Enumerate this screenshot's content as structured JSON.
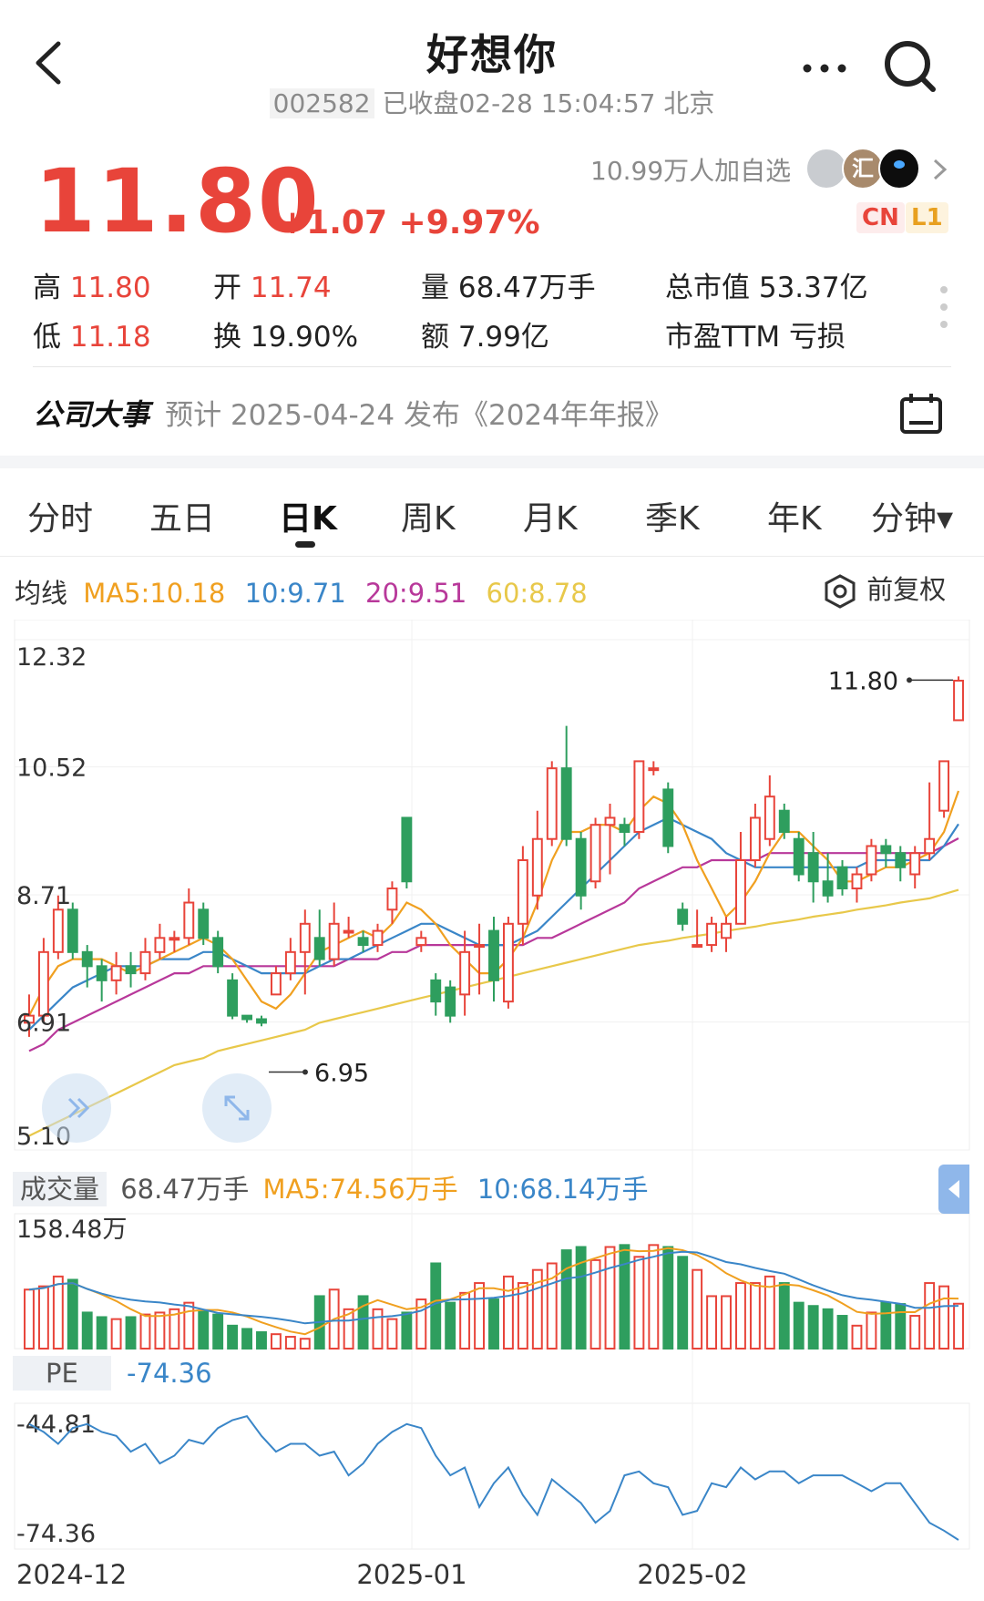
{
  "header": {
    "title": "好想你",
    "code": "002582",
    "status": "已收盘02-28 15:04:57 北京"
  },
  "quote": {
    "price": "11.80",
    "change": "+1.07",
    "change_pct": "+9.97%",
    "watchers": "10.99万人加自选",
    "badge_cn": "CN",
    "badge_l1": "L1",
    "avatar_text": "汇"
  },
  "stats": {
    "high_label": "高",
    "high_value": "11.80",
    "open_label": "开",
    "open_value": "11.74",
    "volume_label": "量",
    "volume_value": "68.47万手",
    "mktcap_label": "总市值",
    "mktcap_value": "53.37亿",
    "low_label": "低",
    "low_value": "11.18",
    "turnover_label": "换",
    "turnover_value": "19.90%",
    "amount_label": "额",
    "amount_value": "7.99亿",
    "pe_label": "市盈TTM",
    "pe_value": "亏损"
  },
  "event": {
    "label": "公司大事",
    "text": "预计 2025-04-24 发布《2024年年报》"
  },
  "tabs": [
    "分时",
    "五日",
    "日K",
    "周K",
    "月K",
    "季K",
    "年K",
    "分钟▾"
  ],
  "active_tab": 2,
  "ma": {
    "label": "均线",
    "ma5": "MA5:10.18",
    "ma10": "10:9.71",
    "ma20": "20:9.51",
    "ma60": "60:8.78",
    "adjust": "前复权"
  },
  "colors": {
    "up": "#e8443a",
    "down": "#2e9e5e",
    "ma5": "#f0a020",
    "ma10": "#3a86c8",
    "ma20": "#b8389a",
    "ma60": "#e8c84a"
  },
  "volume": {
    "label": "成交量",
    "value": "68.47万手",
    "ma5": "MA5:74.56万手",
    "ma10": "10:68.14万手",
    "max_label": "158.48万"
  },
  "pe": {
    "label": "PE",
    "value": "-74.36",
    "top_label": "-44.81",
    "bottom_label": "-74.36"
  },
  "chart_data": {
    "type": "candlestick",
    "y_ticks": [
      "12.32",
      "10.52",
      "8.71",
      "6.91",
      "5.10"
    ],
    "ylim": [
      5.1,
      12.32
    ],
    "x_ticks": [
      "2024-12",
      "2025-01",
      "2025-02"
    ],
    "high_marker": "11.80",
    "low_marker": "6.95",
    "candles": [
      [
        6.9,
        7.0,
        6.7,
        7.3
      ],
      [
        7.0,
        7.9,
        6.9,
        8.1
      ],
      [
        7.9,
        8.5,
        7.8,
        8.7
      ],
      [
        8.5,
        7.9,
        7.8,
        8.6
      ],
      [
        7.9,
        7.7,
        7.4,
        8.0
      ],
      [
        7.7,
        7.5,
        7.2,
        7.8
      ],
      [
        7.5,
        7.7,
        7.3,
        7.9
      ],
      [
        7.7,
        7.6,
        7.4,
        7.9
      ],
      [
        7.6,
        7.9,
        7.5,
        8.1
      ],
      [
        7.9,
        8.1,
        7.8,
        8.3
      ],
      [
        8.1,
        8.1,
        7.9,
        8.2
      ],
      [
        8.1,
        8.6,
        8.0,
        8.8
      ],
      [
        8.5,
        8.1,
        8.0,
        8.6
      ],
      [
        8.1,
        7.7,
        7.6,
        8.2
      ],
      [
        7.5,
        7.0,
        6.95,
        7.6
      ],
      [
        7.0,
        6.95,
        6.9,
        7.0
      ],
      [
        6.95,
        6.9,
        6.85,
        7.0
      ],
      [
        7.3,
        7.6,
        7.3,
        7.7
      ],
      [
        7.6,
        7.9,
        7.5,
        8.1
      ],
      [
        7.9,
        8.3,
        7.3,
        8.5
      ],
      [
        8.1,
        7.8,
        7.7,
        8.5
      ],
      [
        7.8,
        8.3,
        7.7,
        8.6
      ],
      [
        8.2,
        8.2,
        8.1,
        8.4
      ],
      [
        8.1,
        8.0,
        7.9,
        8.2
      ],
      [
        8.0,
        8.2,
        7.9,
        8.3
      ],
      [
        8.5,
        8.8,
        8.3,
        8.9
      ],
      [
        9.8,
        8.9,
        8.8,
        9.8
      ],
      [
        8.0,
        8.1,
        7.9,
        8.2
      ],
      [
        7.5,
        7.2,
        7.0,
        7.6
      ],
      [
        7.4,
        7.0,
        6.9,
        7.5
      ],
      [
        7.3,
        7.9,
        7.0,
        8.2
      ],
      [
        8.0,
        8.0,
        7.3,
        8.3
      ],
      [
        8.2,
        7.5,
        7.2,
        8.4
      ],
      [
        7.2,
        8.3,
        7.1,
        8.4
      ],
      [
        8.3,
        9.2,
        8.0,
        9.4
      ],
      [
        8.7,
        9.5,
        8.5,
        9.9
      ],
      [
        9.5,
        10.5,
        9.4,
        10.6
      ],
      [
        10.5,
        9.5,
        9.4,
        11.1
      ],
      [
        9.5,
        8.7,
        8.5,
        9.6
      ],
      [
        8.9,
        9.7,
        8.8,
        9.8
      ],
      [
        9.7,
        9.8,
        9.0,
        10.0
      ],
      [
        9.7,
        9.6,
        9.4,
        9.8
      ],
      [
        9.6,
        10.6,
        9.5,
        10.6
      ],
      [
        10.5,
        10.5,
        10.4,
        10.6
      ],
      [
        10.2,
        9.4,
        9.3,
        10.3
      ],
      [
        8.5,
        8.3,
        8.2,
        8.6
      ],
      [
        8.0,
        8.0,
        8.0,
        8.5
      ],
      [
        8.0,
        8.3,
        7.9,
        8.4
      ],
      [
        8.1,
        8.3,
        7.9,
        8.4
      ],
      [
        8.3,
        9.2,
        8.3,
        9.6
      ],
      [
        9.2,
        9.8,
        9.1,
        10.0
      ],
      [
        9.5,
        10.1,
        9.4,
        10.4
      ],
      [
        9.9,
        9.6,
        9.5,
        10.0
      ],
      [
        9.5,
        9.0,
        8.9,
        9.6
      ],
      [
        9.3,
        8.9,
        8.6,
        9.6
      ],
      [
        8.9,
        8.7,
        8.6,
        9.3
      ],
      [
        9.1,
        8.8,
        8.7,
        9.2
      ],
      [
        8.8,
        9.0,
        8.6,
        9.1
      ],
      [
        9.0,
        9.4,
        8.9,
        9.5
      ],
      [
        9.4,
        9.3,
        9.1,
        9.5
      ],
      [
        9.3,
        9.1,
        8.9,
        9.4
      ],
      [
        9.0,
        9.3,
        8.8,
        9.4
      ],
      [
        9.3,
        9.5,
        9.2,
        10.3
      ],
      [
        9.9,
        10.6,
        9.8,
        10.6
      ],
      [
        11.18,
        11.74,
        11.18,
        11.8
      ]
    ],
    "ma5": [
      7.0,
      7.4,
      7.7,
      7.8,
      7.8,
      7.8,
      7.7,
      7.6,
      7.7,
      7.8,
      7.9,
      8.0,
      8.1,
      8.0,
      7.8,
      7.5,
      7.2,
      7.1,
      7.3,
      7.6,
      7.9,
      8.0,
      8.1,
      8.2,
      8.1,
      8.3,
      8.6,
      8.5,
      8.3,
      8.0,
      7.8,
      7.6,
      7.6,
      7.8,
      8.1,
      8.6,
      9.2,
      9.6,
      9.6,
      9.7,
      9.7,
      9.6,
      9.9,
      10.1,
      10.0,
      9.7,
      9.2,
      8.8,
      8.4,
      8.6,
      8.9,
      9.3,
      9.6,
      9.6,
      9.4,
      9.2,
      8.9,
      8.9,
      9.0,
      9.1,
      9.1,
      9.2,
      9.3,
      9.6,
      10.18
    ],
    "ma10": [
      6.8,
      7.0,
      7.2,
      7.4,
      7.5,
      7.6,
      7.7,
      7.7,
      7.7,
      7.8,
      7.8,
      7.8,
      7.9,
      7.9,
      7.8,
      7.7,
      7.6,
      7.6,
      7.6,
      7.6,
      7.7,
      7.8,
      7.8,
      7.9,
      8.0,
      8.1,
      8.2,
      8.3,
      8.3,
      8.2,
      8.1,
      8.0,
      8.0,
      8.0,
      8.1,
      8.2,
      8.4,
      8.6,
      8.8,
      9.0,
      9.2,
      9.4,
      9.6,
      9.7,
      9.8,
      9.7,
      9.6,
      9.5,
      9.3,
      9.2,
      9.1,
      9.1,
      9.1,
      9.1,
      9.1,
      9.1,
      9.1,
      9.1,
      9.2,
      9.2,
      9.2,
      9.2,
      9.2,
      9.4,
      9.71
    ],
    "ma20": [
      6.5,
      6.6,
      6.8,
      6.9,
      7.0,
      7.1,
      7.2,
      7.3,
      7.4,
      7.5,
      7.6,
      7.6,
      7.7,
      7.7,
      7.7,
      7.7,
      7.7,
      7.7,
      7.7,
      7.7,
      7.7,
      7.7,
      7.8,
      7.8,
      7.8,
      7.9,
      7.9,
      8.0,
      8.0,
      8.0,
      8.0,
      8.0,
      8.0,
      8.0,
      8.0,
      8.1,
      8.1,
      8.2,
      8.3,
      8.4,
      8.5,
      8.6,
      8.8,
      8.9,
      9.0,
      9.1,
      9.1,
      9.2,
      9.2,
      9.2,
      9.2,
      9.3,
      9.3,
      9.3,
      9.3,
      9.3,
      9.3,
      9.3,
      9.3,
      9.3,
      9.3,
      9.3,
      9.3,
      9.4,
      9.51
    ],
    "ma60": [
      5.3,
      5.4,
      5.5,
      5.6,
      5.7,
      5.8,
      5.9,
      6.0,
      6.1,
      6.2,
      6.3,
      6.35,
      6.4,
      6.5,
      6.55,
      6.6,
      6.65,
      6.7,
      6.75,
      6.8,
      6.9,
      6.95,
      7.0,
      7.05,
      7.1,
      7.15,
      7.2,
      7.25,
      7.3,
      7.35,
      7.4,
      7.45,
      7.5,
      7.55,
      7.6,
      7.65,
      7.7,
      7.75,
      7.8,
      7.85,
      7.9,
      7.95,
      8.0,
      8.03,
      8.06,
      8.1,
      8.13,
      8.16,
      8.2,
      8.23,
      8.26,
      8.3,
      8.33,
      8.36,
      8.4,
      8.43,
      8.46,
      8.5,
      8.53,
      8.56,
      8.6,
      8.63,
      8.66,
      8.72,
      8.78
    ],
    "volume_max": 158.48,
    "volumes": [
      90,
      95,
      110,
      105,
      55,
      48,
      45,
      48,
      52,
      55,
      60,
      70,
      58,
      52,
      35,
      30,
      25,
      22,
      18,
      15,
      80,
      90,
      60,
      80,
      60,
      45,
      55,
      75,
      130,
      70,
      85,
      100,
      75,
      110,
      100,
      120,
      130,
      150,
      155,
      135,
      155,
      158,
      140,
      158,
      155,
      140,
      120,
      80,
      80,
      100,
      100,
      110,
      100,
      70,
      65,
      60,
      50,
      35,
      55,
      70,
      68,
      50,
      100,
      95,
      68.47
    ],
    "pe_series": [
      -45,
      -47,
      -50,
      -46,
      -45,
      -47,
      -48,
      -52,
      -50,
      -55,
      -53,
      -49,
      -50,
      -46,
      -44,
      -43,
      -48,
      -52,
      -50,
      -50,
      -53,
      -52,
      -58,
      -55,
      -50,
      -47,
      -45,
      -46,
      -53,
      -58,
      -56,
      -66,
      -60,
      -56,
      -63,
      -68,
      -59,
      -62,
      -65,
      -70,
      -67,
      -58,
      -57,
      -60,
      -61,
      -68,
      -67,
      -60,
      -61,
      -56,
      -59,
      -57,
      -57,
      -60,
      -58,
      -58,
      -58,
      -60,
      -62,
      -60,
      -60,
      -65,
      -70,
      -72,
      -74.36
    ]
  }
}
